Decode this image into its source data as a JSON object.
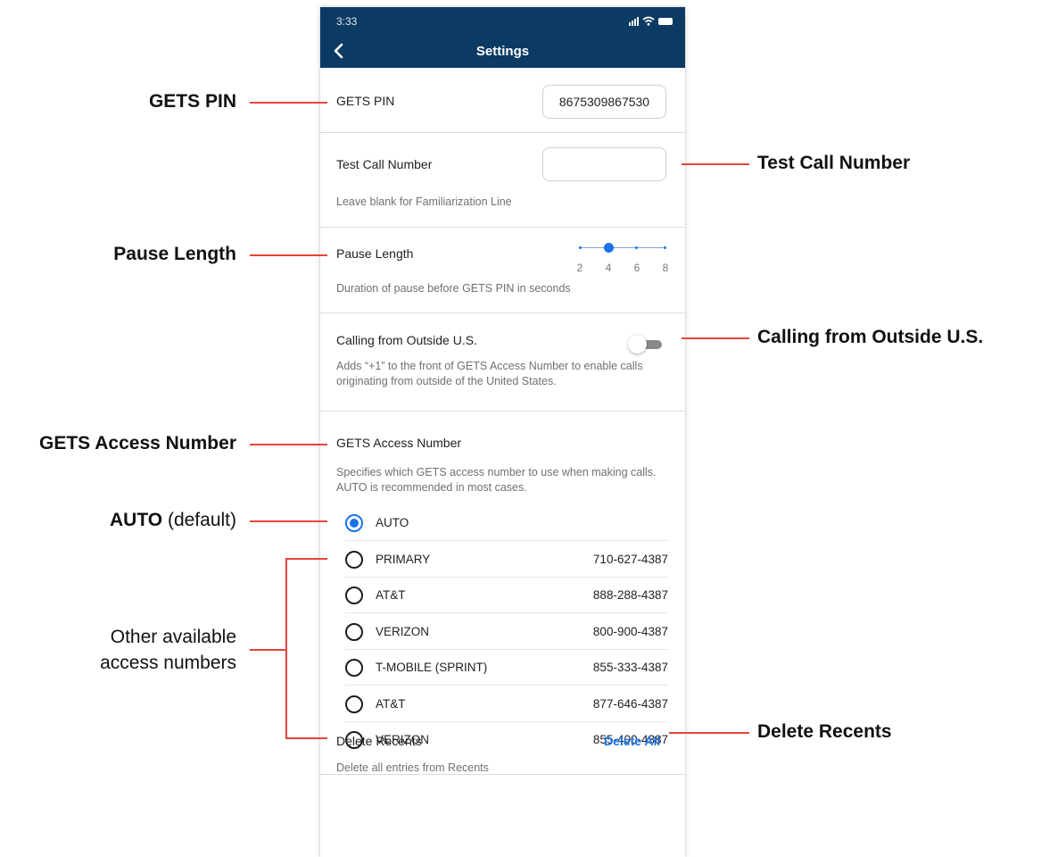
{
  "status_bar": {
    "time": "3:33"
  },
  "header": {
    "title": "Settings"
  },
  "gets_pin": {
    "label": "GETS PIN",
    "value": "8675309867530"
  },
  "test_call": {
    "label": "Test Call Number",
    "value": "",
    "description": "Leave blank for Familiarization Line"
  },
  "pause_length": {
    "label": "Pause Length",
    "ticks": [
      "2",
      "4",
      "6",
      "8"
    ],
    "value": 4,
    "description": "Duration of pause before GETS PIN in seconds"
  },
  "outside_us": {
    "label": "Calling from Outside U.S.",
    "enabled": false,
    "description": "Adds “+1” to the front of GETS Access Number to enable calls originating from outside of the United States."
  },
  "access_number": {
    "label": "GETS Access Number",
    "description": "Specifies which GETS access number to use when making calls. AUTO is recommended in most cases.",
    "options": [
      {
        "name": "AUTO",
        "number": "",
        "selected": true
      },
      {
        "name": "PRIMARY",
        "number": "710-627-4387",
        "selected": false
      },
      {
        "name": "AT&T",
        "number": "888-288-4387",
        "selected": false
      },
      {
        "name": "VERIZON",
        "number": "800-900-4387",
        "selected": false
      },
      {
        "name": "T-MOBILE (SPRINT)",
        "number": "855-333-4387",
        "selected": false
      },
      {
        "name": "AT&T",
        "number": "877-646-4387",
        "selected": false
      },
      {
        "name": "VERIZON",
        "number": "855-400-4387",
        "selected": false
      }
    ]
  },
  "delete_recents": {
    "label": "Delete Recents",
    "action": "Delete All",
    "description": "Delete all entries from Recents"
  },
  "callouts": {
    "gets_pin": "GETS PIN",
    "test_call_number": "Test Call Number",
    "pause_length": "Pause Length",
    "calling_outside": "Calling from Outside U.S.",
    "gets_access_number": "GETS Access Number",
    "auto_bold": "AUTO",
    "auto_rest": " (default)",
    "other_line1": "Other available",
    "other_line2": "access numbers",
    "delete_recents": "Delete Recents"
  },
  "colors": {
    "header_bg": "#0b3a63",
    "accent": "#1a73e8",
    "callout_line": "#e5453b"
  }
}
